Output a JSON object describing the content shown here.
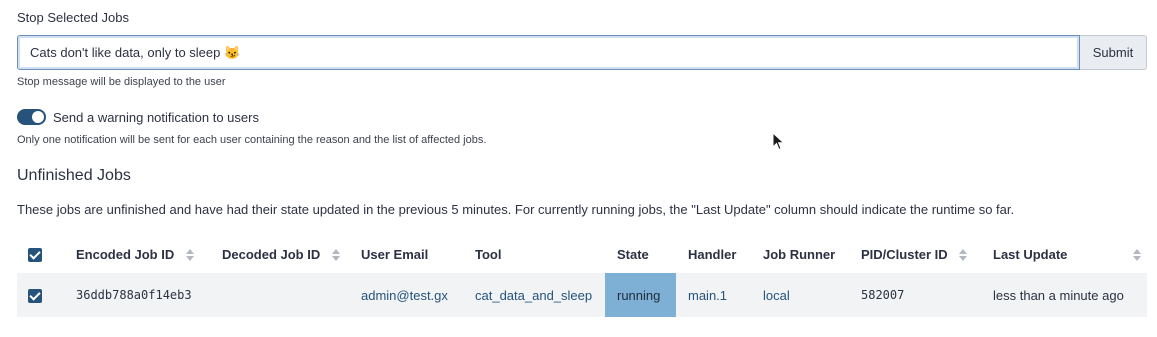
{
  "form": {
    "title": "Stop Selected Jobs",
    "stop_message": "Cats don't like data, only to sleep 😼",
    "submit_label": "Submit",
    "help_text": "Stop message will be displayed to the user",
    "notify_label": "Send a warning notification to users",
    "notify_enabled": true,
    "notify_help": "Only one notification will be sent for each user containing the reason and the list of affected jobs."
  },
  "section": {
    "title": "Unfinished Jobs",
    "description": "These jobs are unfinished and have had their state updated in the previous 5 minutes. For currently running jobs, the \"Last Update\" column should indicate the runtime so far."
  },
  "table": {
    "headers": {
      "encoded_id": "Encoded Job ID",
      "decoded_id": "Decoded Job ID",
      "user_email": "User Email",
      "tool": "Tool",
      "state": "State",
      "handler": "Handler",
      "job_runner": "Job Runner",
      "pid": "PID/Cluster ID",
      "last_update": "Last Update"
    },
    "rows": [
      {
        "encoded_id": "36ddb788a0f14eb3",
        "decoded_id": "",
        "user_email": "admin@test.gx",
        "tool": "cat_data_and_sleep",
        "state": "running",
        "handler": "main.1",
        "job_runner": "local",
        "pid": "582007",
        "last_update": "less than a minute ago"
      }
    ]
  },
  "colors": {
    "accent": "#25537b",
    "state_running": "#7eafd4",
    "row_bg": "#f1f3f5"
  }
}
